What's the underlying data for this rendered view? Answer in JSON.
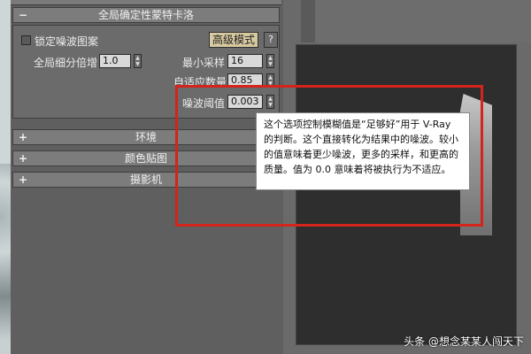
{
  "rollout": {
    "collapse_symbol": "−",
    "title": "全局确定性蒙特卡洛",
    "lock_noise_label": "锁定噪波图案",
    "advanced_button": "高级模式",
    "help_button": "?",
    "global_subdiv_label": "全局细分倍增",
    "global_subdiv_value": "1.0",
    "min_samples_label": "最小采样",
    "min_samples_value": "16",
    "adaptive_label": "自适应数量",
    "adaptive_value": "0.85",
    "noise_threshold_label": "噪波阈值",
    "noise_threshold_value": "0.003"
  },
  "collapsed": [
    {
      "symbol": "+",
      "label": "环境"
    },
    {
      "symbol": "+",
      "label": "颜色贴图"
    },
    {
      "symbol": "+",
      "label": "摄影机"
    }
  ],
  "tooltip": {
    "text": "这个选项控制模糊值是“足够好”用于 V-Ray 的判断。这个直接转化为结果中的噪波。较小的值意味着更少噪波，更多的采样，和更高的质量。值为 0.0 意味着将被执行为不适应。"
  },
  "watermark": "头条 @想念某某人闯天下",
  "colors": {
    "annotation_red": "#d4241c",
    "advanced_button_bg": "#d7c9a0"
  }
}
